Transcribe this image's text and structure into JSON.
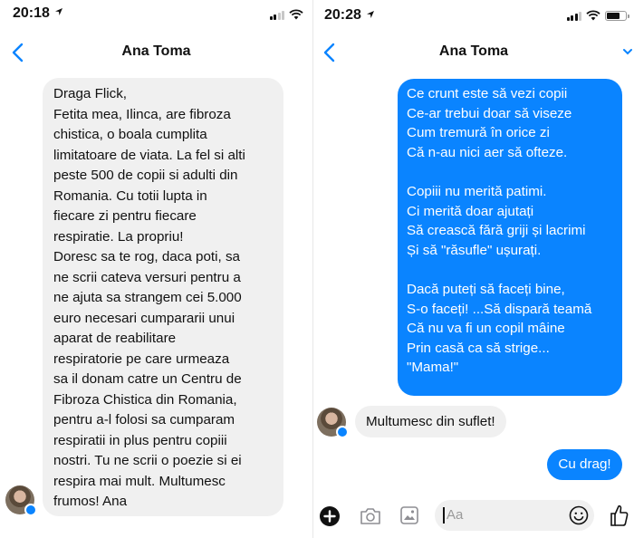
{
  "left": {
    "status": {
      "time": "20:18"
    },
    "header": {
      "contact_name": "Ana Toma"
    },
    "incoming_message": "Draga Flick,\nFetita mea, Ilinca, are fibroza\nchistica, o boala cumplita\nlimitatoare de viata. La fel si alti\npeste 500 de copii si adulti din\nRomania. Cu totii lupta in\nfiecare zi pentru fiecare\nrespiratie. La propriu!\nDoresc sa te rog, daca poti, sa\nne scrii cateva versuri pentru a\nne ajuta sa strangem cei 5.000\neuro necesari cumpararii unui\naparat de reabilitare\nrespiratorie pe care urmeaza\nsa il donam catre un Centru de\nFibroza Chistica din Romania,\npentru a-l folosi sa cumparam\nrespiratii in plus pentru copiii\nnostri. Tu ne scrii o poezie si ei\nrespira mai mult. Multumesc\nfrumos! Ana"
  },
  "right": {
    "status": {
      "time": "20:28"
    },
    "header": {
      "contact_name": "Ana Toma"
    },
    "poem_message": "Ce crunt este să vezi copii\nCe-ar trebui doar să viseze\nCum tremură în orice zi\nCă n-au nici aer să ofteze.\n\nCopiii nu merită patimi.\nCi merită doar ajutați\nSă crească fără griji și lacrimi\nȘi să \"răsufle\" ușurați.\n\nDacă puteți să faceți bine,\nS-o faceți! ...Să dispară teamă\nCă nu va fi un copil mâine\nPrin casă ca să strige...\n\"Mama!\"",
    "incoming_reply": "Multumesc din suflet!",
    "outgoing_reply": "Cu drag!",
    "composer": {
      "placeholder": "Aa"
    }
  },
  "colors": {
    "accent": "#0a84ff",
    "incoming_bubble": "#f0f0f0",
    "icon_gray": "#8e8e93"
  }
}
